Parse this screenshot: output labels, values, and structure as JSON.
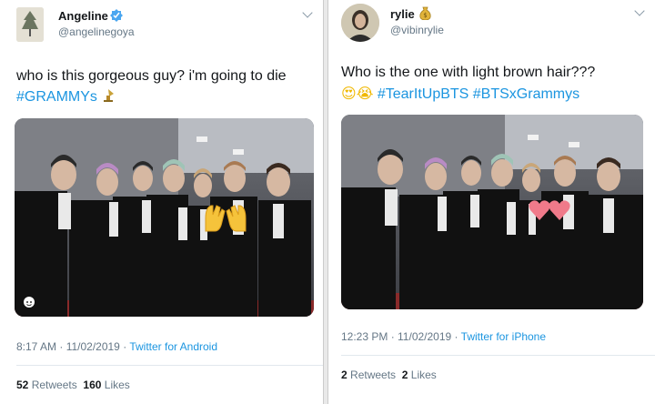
{
  "left_tweet": {
    "display_name": "Angeline",
    "verified_icon": "verified-badge-icon",
    "handle": "@angelinegoya",
    "text_line1": "who is this gorgeous guy? i'm going to die",
    "hashtag": "#GRAMMYs",
    "hashtag_emoji": "gramophone-icon",
    "photo_overlay_emoji": "raised-hands-emoji",
    "timestamp": "8:17 AM · 11/02/2019 · ",
    "source": "Twitter for Android",
    "retweets_count": "52",
    "retweets_label": "Retweets",
    "likes_count": "160",
    "likes_label": "Likes"
  },
  "right_tweet": {
    "display_name": "rylie",
    "name_emoji": "money-bag-icon",
    "handle": "@vibinrylie",
    "text_line1": "Who is the one with light brown hair???",
    "emoji_1": "😍",
    "emoji_2": "😭",
    "hashtag_1": "#TearItUpBTS",
    "hashtag_2": "#BTSxGrammys",
    "photo_overlay_emoji": "two-hearts-emoji",
    "timestamp": "12:23 PM · 11/02/2019 · ",
    "source": "Twitter for iPhone",
    "retweets_count": "2",
    "retweets_label": "Retweets",
    "likes_count": "2",
    "likes_label": "Likes"
  },
  "colors": {
    "link_blue": "#1b95e0",
    "text_dark": "#14171a",
    "text_muted": "#657786"
  }
}
